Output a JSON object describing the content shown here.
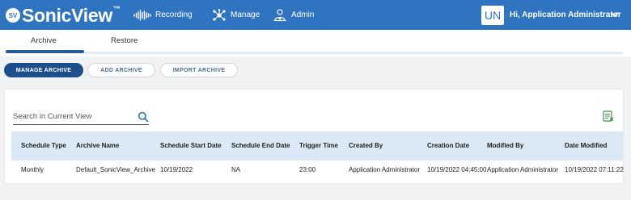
{
  "app": {
    "logo_text": "SV",
    "name": "SonicView",
    "trademark": "™"
  },
  "nav": {
    "recording": "Recording",
    "manage": "Manage",
    "admin": "Admin"
  },
  "user": {
    "initials": "UN",
    "greeting": "Hi, Application Administrator"
  },
  "tabs": {
    "archive": "Archive",
    "restore": "Restore",
    "active": "Archive"
  },
  "actions": {
    "manage_archive": "MANAGE ARCHIVE",
    "add_archive": "ADD ARCHIVE",
    "import_archive": "IMPORT ARCHIVE"
  },
  "search": {
    "placeholder": "Search in Current View"
  },
  "table": {
    "columns": [
      "Schedule Type",
      "Archive Name",
      "Schedule Start Date",
      "Schedule End Date",
      "Trigger Time",
      "Created By",
      "Creation Date",
      "Modified By",
      "Date Modified"
    ],
    "rows": [
      [
        "Monthly",
        "Default_SonicView_Archive",
        "10/19/2022",
        "NA",
        "23:00",
        "Application Administrator",
        "10/19/2022 04:45:00",
        "Application Administrator",
        "10/19/2022 07:11:22"
      ]
    ]
  },
  "colors": {
    "header": "#2f74c0",
    "primary_button": "#1d4f8c",
    "table_header": "#dbe8f5"
  },
  "icons": [
    "waveform-icon",
    "network-icon",
    "admin-person-icon",
    "chevron-down-icon",
    "search-icon",
    "export-excel-icon"
  ]
}
